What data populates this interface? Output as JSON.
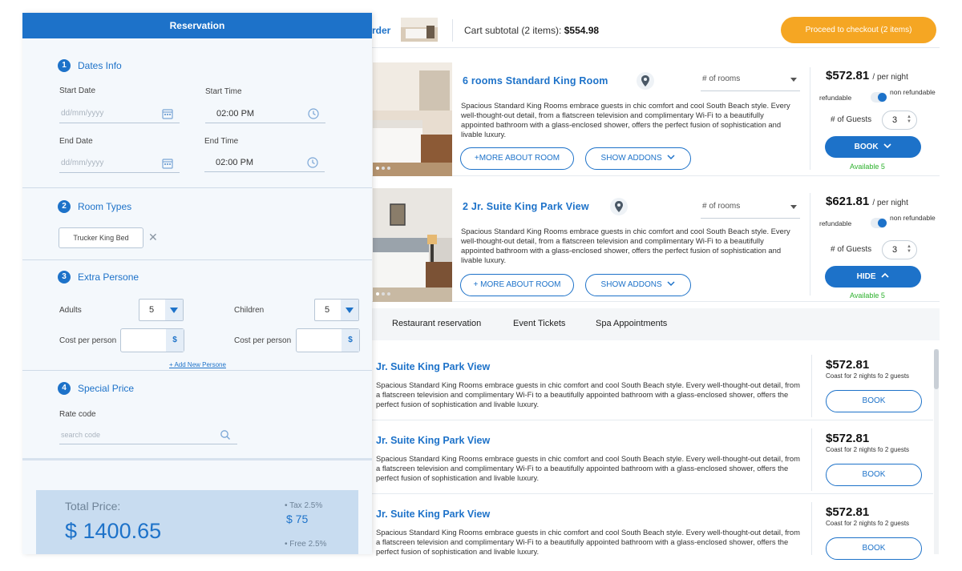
{
  "reservation": {
    "header": "Reservation",
    "dates": {
      "step": "1",
      "title": "Dates Info",
      "start_date_label": "Start Date",
      "start_date_placeholder": "dd/mm/yyyy",
      "start_time_label": "Start Time",
      "start_time_value": "02:00 PM",
      "end_date_label": "End Date",
      "end_date_placeholder": "dd/mm/yyyy",
      "end_time_label": "End Time",
      "end_time_value": "02:00 PM"
    },
    "room_types": {
      "step": "2",
      "title": "Room Types",
      "chip": "Trucker King Bed",
      "chip_close": "✕"
    },
    "extra": {
      "step": "3",
      "title": "Extra Persone",
      "adults_label": "Adults",
      "adults_value": "5",
      "children_label": "Children",
      "children_value": "5",
      "cost_label": "Cost per person",
      "currency": "$",
      "add_link": "+ Add New Persone"
    },
    "special": {
      "step": "4",
      "title": "Special Price",
      "rate_label": "Rate code",
      "rate_placeholder": "search code"
    },
    "total": {
      "label": "Total Price:",
      "value": "$ 1400.65",
      "tax_label": "• Tax 2.5%",
      "tax_value": "$ 75",
      "free_label": "• Free 2.5%"
    }
  },
  "top_bar": {
    "order_link": "rder",
    "subtotal_label": "Cart subtotal (2 items):",
    "subtotal_value": "$554.98",
    "checkout_label": "Proceed to checkout (2 items)"
  },
  "rooms": [
    {
      "title": "6 rooms Standard King Room",
      "rooms_placeholder": "# of rooms",
      "desc": "Spacious Standard King Rooms embrace guests in chic comfort and cool South Beach style. Every well-thought-out detail, from a flatscreen television and complimentary Wi-Fi to a beautifully appointed bathroom with a glass-enclosed shower, offers the perfect fusion of sophistication and livable luxury.",
      "more_label": "+MORE ABOUT ROOM",
      "addons_label": "SHOW ADDONS",
      "price": "$572.81",
      "per_night": "/ per night",
      "refundable": "refundable",
      "non_refundable": "non refundable",
      "guests_label": "# of Guests",
      "guests_value": "3",
      "action_label": "BOOK",
      "available": "Available 5"
    },
    {
      "title": "2 Jr. Suite King Park View",
      "rooms_placeholder": "# of rooms",
      "desc": "Spacious Standard King Rooms embrace guests in chic comfort and cool South Beach style. Every well-thought-out detail, from a flatscreen television and complimentary Wi-Fi to a beautifully appointed bathroom with a glass-enclosed shower, offers the perfect fusion of sophistication and livable luxury.",
      "more_label": "+ MORE ABOUT ROOM",
      "addons_label": "SHOW ADDONS",
      "price": "$621.81",
      "per_night": "/ per night",
      "refundable": "refundable",
      "non_refundable": "non refundable",
      "guests_label": "# of Guests",
      "guests_value": "3",
      "action_label": "HIDE",
      "available": "Available 5"
    }
  ],
  "tabs": [
    "Restaurant reservation",
    "Event Tickets",
    "Spa Appointments"
  ],
  "addons": [
    {
      "title": "Jr. Suite King Park View",
      "desc": "Spacious Standard King Rooms embrace guests in chic comfort and cool South Beach style. Every well-thought-out detail, from a flatscreen television and complimentary Wi-Fi to a beautifully appointed bathroom with a glass-enclosed shower, offers the perfect fusion of sophistication and livable luxury.",
      "price": "$572.81",
      "note": "Coast for 2 nights fo 2 guests",
      "book": "BOOK"
    },
    {
      "title": "Jr. Suite King Park View",
      "desc": "Spacious Standard King Rooms embrace guests in chic comfort and cool South Beach style. Every well-thought-out detail, from a flatscreen television and complimentary Wi-Fi to a beautifully appointed bathroom with a glass-enclosed shower, offers the perfect fusion of sophistication and livable luxury.",
      "price": "$572.81",
      "note": "Coast for 2 nights fo 2 guests",
      "book": "BOOK"
    },
    {
      "title": "Jr. Suite King Park View",
      "desc": "Spacious Standard King Rooms embrace guests in chic comfort and cool South Beach style. Every well-thought-out detail, from a flatscreen television and complimentary Wi-Fi to a beautifully appointed bathroom with a glass-enclosed shower, offers the perfect fusion of sophistication and livable luxury.",
      "price": "$572.81",
      "note": "Coast for 2 nights fo 2 guests",
      "book": "BOOK"
    }
  ],
  "colors": {
    "primary": "#1d72c9",
    "checkout": "#f5a623",
    "available": "#2db12d",
    "total_bg": "#c8dcf0"
  },
  "icons": [
    "calendar-icon",
    "clock-icon",
    "close-icon",
    "search-icon",
    "location-pin-icon",
    "chevron-down-icon",
    "chevron-up-icon"
  ]
}
